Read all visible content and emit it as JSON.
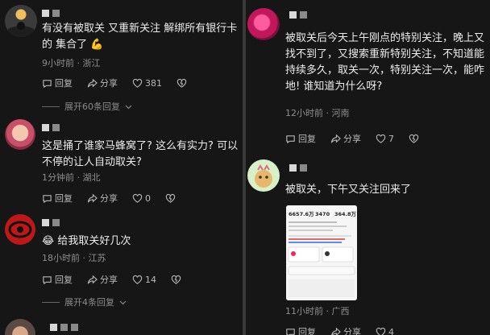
{
  "left": {
    "comments": [
      {
        "text_line1": "有没有被取关 又重新关注  解绑所有银行卡",
        "text_line2": "的 集合了",
        "emoji": "💪",
        "meta": "9小时前 · 浙江",
        "reply_label": "回复",
        "share_label": "分享",
        "likes": "381",
        "expand_label": "展开60条回复"
      },
      {
        "text_line1": "这是捅了谁家马蜂窝了? 这么有实力? 可以",
        "text_line2": "不停的让人自动取关?",
        "meta": "1分钟前 · 湖北",
        "reply_label": "回复",
        "share_label": "分享",
        "likes": "0"
      },
      {
        "emoji": "😂",
        "text_line1": "给我取关好几次",
        "meta": "18小时前 · 江苏",
        "reply_label": "回复",
        "share_label": "分享",
        "likes": "14",
        "expand_label": "展开4条回复"
      }
    ]
  },
  "right": {
    "comments": [
      {
        "text_line1": "被取关后今天上午刚点的特别关注，晚上又",
        "text_line2": "找不到了，又搜索重新特别关注，不知道能",
        "text_line3": "持续多久，取关一次，特别关注一次，能咋",
        "text_line4": "地! 谁知道为什么呀?",
        "meta": "12小时前 · 河南",
        "reply_label": "回复",
        "share_label": "分享",
        "likes": "7"
      },
      {
        "text_line1": "被取关，下午又关注回来了",
        "image_stats": [
          "6657.6万",
          "3470",
          "364.8万"
        ],
        "meta": "11小时前 · 广西",
        "reply_label": "回复",
        "share_label": "分享",
        "likes": "4"
      }
    ]
  },
  "colors": {
    "background": "#161616",
    "text": "#ececec",
    "meta": "#8e8e8e"
  }
}
